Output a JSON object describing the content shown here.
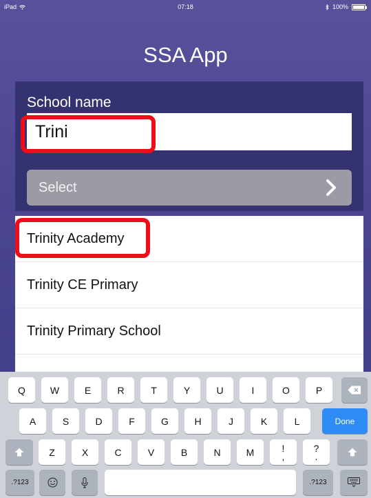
{
  "status_bar": {
    "device": "iPad",
    "time": "07:18",
    "battery": "100%"
  },
  "app": {
    "title": "SSA App"
  },
  "form": {
    "school_label": "School name",
    "school_value": "Trini",
    "select_label": "Select"
  },
  "results": [
    {
      "label": "Trinity Academy"
    },
    {
      "label": "Trinity CE Primary"
    },
    {
      "label": "Trinity Primary School"
    },
    {
      "label": ""
    }
  ],
  "keyboard": {
    "row1": [
      "Q",
      "W",
      "E",
      "R",
      "T",
      "Y",
      "U",
      "I",
      "O",
      "P"
    ],
    "row2": [
      "A",
      "S",
      "D",
      "F",
      "G",
      "H",
      "J",
      "K",
      "L"
    ],
    "row3": [
      "Z",
      "X",
      "C",
      "V",
      "B",
      "N",
      "M"
    ],
    "punct1_top": "!",
    "punct1_bottom": ",",
    "punct2_top": "?",
    "punct2_bottom": ".",
    "done_label": "Done",
    "numbers_label_left": ".?123",
    "numbers_label_right": ".?123",
    "icons": [
      "backspace-icon",
      "shift-icon",
      "emoji-icon",
      "microphone-icon",
      "keyboard-dismiss-icon",
      "wifi-icon",
      "bluetooth-icon",
      "chevron-right-icon"
    ]
  },
  "colors": {
    "background": "#4b4590",
    "panel": "#353272",
    "highlight": "#ee0e1a",
    "done_key": "#2f8cf5"
  }
}
